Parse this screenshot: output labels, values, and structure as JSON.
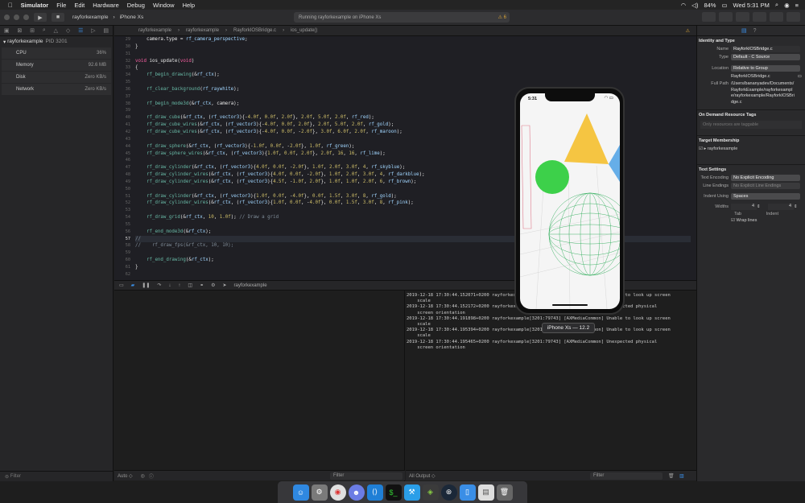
{
  "menubar": {
    "app": "Simulator",
    "items": [
      "File",
      "Edit",
      "Hardware",
      "Debug",
      "Window",
      "Help"
    ],
    "battery": "84%",
    "time": "Wed 5:31 PM"
  },
  "toolbar": {
    "scheme": "rayforkexample",
    "device": "iPhone Xs",
    "status": "Running rayforkexample on iPhone Xs",
    "warnings": "⚠ 6"
  },
  "navigator": {
    "process": "rayforkexample",
    "pid": "PID 3201",
    "gauges": [
      {
        "name": "CPU",
        "value": "36%"
      },
      {
        "name": "Memory",
        "value": "92.6 MB"
      },
      {
        "name": "Disk",
        "value": "Zero KB/s"
      },
      {
        "name": "Network",
        "value": "Zero KB/s"
      }
    ],
    "filter": "Filter"
  },
  "jumpbar": {
    "crumbs": [
      "rayforkexample",
      "rayforkexample",
      "RayforkIOSBridge.c",
      "ios_update()"
    ]
  },
  "code": {
    "start": 29,
    "highlight": 57,
    "lines": [
      "    camera.type = rf_camera_perspective;",
      "}",
      "",
      "void ios_update(void)",
      "{",
      "    rf_begin_drawing(&rf_ctx);",
      "",
      "    rf_clear_background(rf_raywhite);",
      "",
      "    rf_begin_mode3d(&rf_ctx, camera);",
      "",
      "    rf_draw_cube(&rf_ctx, (rf_vector3){-4.0f, 0.0f, 2.0f}, 2.0f, 5.0f, 2.0f, rf_red);",
      "    rf_draw_cube_wires(&rf_ctx, (rf_vector3){-4.0f, 0.0f, 2.0f}, 2.0f, 5.0f, 2.0f, rf_gold);",
      "    rf_draw_cube_wires(&rf_ctx, (rf_vector3){-4.0f, 0.0f, -2.0f}, 3.0f, 6.0f, 2.0f, rf_maroon);",
      "",
      "    rf_draw_sphere(&rf_ctx, (rf_vector3){-1.0f, 0.0f, -2.0f}, 1.0f, rf_green);",
      "    rf_draw_sphere_wires(&rf_ctx, (rf_vector3){1.0f, 0.0f, 2.0f}, 2.0f, 16, 16, rf_lime);",
      "",
      "    rf_draw_cylinder(&rf_ctx, (rf_vector3){4.0f, 0.0f, -2.0f}, 1.0f, 2.0f, 3.0f, 4, rf_skyblue);",
      "    rf_draw_cylinder_wires(&rf_ctx, (rf_vector3){4.0f, 0.0f, -2.0f}, 1.0f, 2.0f, 3.0f, 4, rf_darkblue);",
      "    rf_draw_cylinder_wires(&rf_ctx, (rf_vector3){4.5f, -1.0f, 2.0f}, 1.0f, 1.0f, 2.0f, 6, rf_brown);",
      "",
      "    rf_draw_cylinder(&rf_ctx, (rf_vector3){1.0f, 0.0f, -4.0f}, 0.0f, 1.5f, 3.0f, 8, rf_gold);",
      "    rf_draw_cylinder_wires(&rf_ctx, (rf_vector3){1.0f, 0.0f, -4.0f}, 0.0f, 1.5f, 3.0f, 8, rf_pink);",
      "",
      "    rf_draw_grid(&rf_ctx, 10, 1.0f); // Draw a grid",
      "",
      "    rf_end_mode3d(&rf_ctx);",
      "//",
      "//    rf_draw_fps(&rf_ctx, 10, 10);",
      "",
      "    rf_end_drawing(&rf_ctx);",
      "}",
      ""
    ]
  },
  "debugbar": {
    "target": "rayforkexample"
  },
  "console": {
    "lines": [
      "2019-12-18 17:30:44.152071+0200 rayforkexample[3201:79743] [AXMediaCommon] Unable to look up screen",
      "    scale",
      "2019-12-18 17:30:44.152172+0200 rayforkexample[3201:79743] [AXMediaCommon] Unexpected physical",
      "    screen orientation",
      "2019-12-18 17:30:44.191898+0200 rayforkexample[3201:79743] [AXMediaCommon] Unable to look up screen",
      "    scale",
      "2019-12-18 17:30:44.195394+0200 rayforkexample[3201:79743] [AXMediaCommon] Unable to look up screen",
      "    scale",
      "2019-12-18 17:30:44.195465+0200 rayforkexample[3201:79743] [AXMediaCommon] Unexpected physical",
      "    screen orientation"
    ],
    "auto": "Auto ◇",
    "output": "All Output ◇",
    "filter": "Filter"
  },
  "inspector": {
    "identity_title": "Identity and Type",
    "name_label": "Name",
    "name": "RayforkIOSBridge.c",
    "type_label": "Type",
    "type": "Default - C Source",
    "location_label": "Location",
    "location": "Relative to Group",
    "location_file": "RayforkIOSBridge.c",
    "fullpath_label": "Full Path",
    "fullpath": "/Users/bananyadev/Documents/RayforkExample/rayforkexample/rayforkexample/RayforkIOSBridge.c",
    "ondemand_title": "On Demand Resource Tags",
    "ondemand_placeholder": "Only resources are taggable",
    "target_title": "Target Membership",
    "target": "rayforkexample",
    "text_title": "Text Settings",
    "encoding_label": "Text Encoding",
    "encoding": "No Explicit Encoding",
    "endings_label": "Line Endings",
    "endings": "No Explicit Line Endings",
    "indent_label": "Indent Using",
    "indent": "Spaces",
    "widths_label": "Widths",
    "tab_value": "4",
    "indent_value": "4",
    "tab_label": "Tab",
    "indent_sub_label": "Indent",
    "wrap_label": "Wrap lines"
  },
  "simulator": {
    "time": "5:31",
    "label": "iPhone Xs — 12.2"
  },
  "dock": [
    "Finder",
    "System Preferences",
    "Chrome",
    "Discord",
    "VS Code",
    "Terminal",
    "Xcode",
    "Android Studio",
    "Steam",
    "Simulator",
    "Preview",
    "Trash"
  ]
}
